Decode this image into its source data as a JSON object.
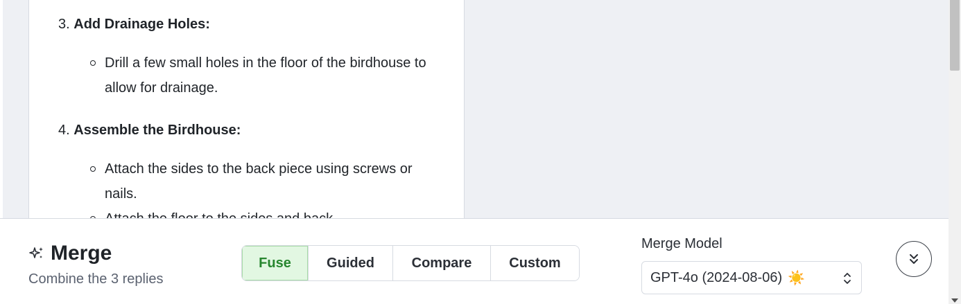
{
  "content": {
    "step3": {
      "number": "3.",
      "title": "Add Drainage Holes:"
    },
    "step3_bullets": [
      "Drill a few small holes in the floor of the birdhouse to allow for drainage."
    ],
    "step4": {
      "number": "4.",
      "title": "Assemble the Birdhouse:"
    },
    "step4_bullets": [
      "Attach the sides to the back piece using screws or nails.",
      "Attach the floor to the sides and back."
    ]
  },
  "merge": {
    "title": "Merge",
    "subtitle": "Combine the 3 replies",
    "modes": [
      "Fuse",
      "Guided",
      "Compare",
      "Custom"
    ],
    "active_mode": "Fuse",
    "model_label": "Merge Model",
    "model_value": "GPT-4o (2024-08-06)",
    "model_emoji": "☀️"
  },
  "icons": {
    "title_icon": "sparkle-icon",
    "select_icon": "chevron-up-down-icon",
    "collapse_icon": "chevrons-down-icon"
  },
  "colors": {
    "active_mode_bg": "#e2f7e2",
    "active_mode_text": "#27862f"
  }
}
